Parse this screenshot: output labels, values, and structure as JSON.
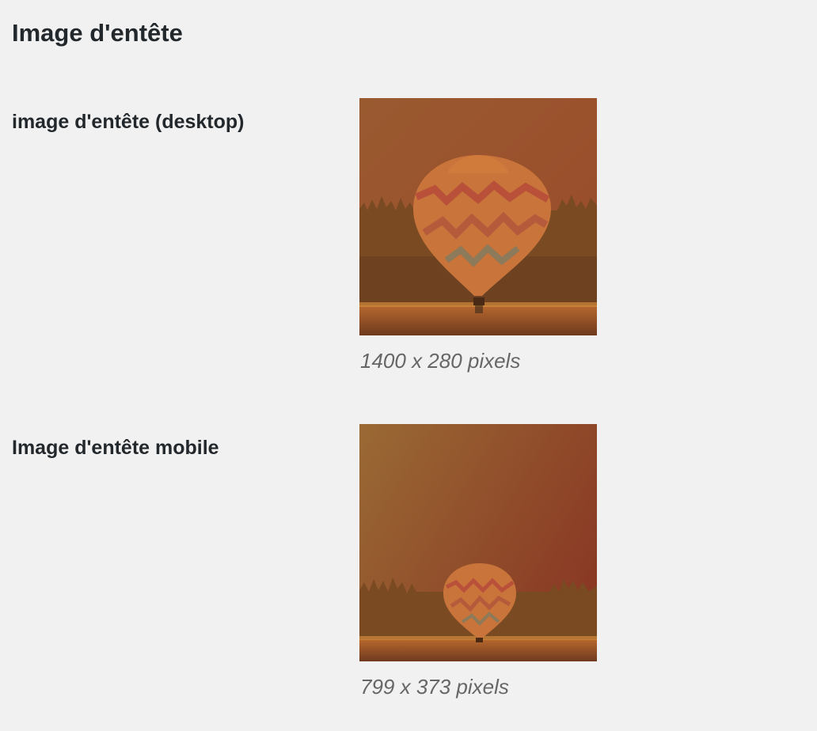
{
  "section": {
    "title": "Image d'entête"
  },
  "fields": [
    {
      "label": "image d'entête (desktop)",
      "dimensions": "1400 x 280 pixels",
      "thumbnail": "hot-air-balloon-orange-tint"
    },
    {
      "label": "Image d'entête mobile",
      "dimensions": "799 x 373 pixels",
      "thumbnail": "hot-air-balloon-orange-tint"
    }
  ],
  "colors": {
    "background": "#f1f1f1",
    "text": "#23282d",
    "caption": "#666666",
    "tint_light": "#a05a2c",
    "tint_dark": "#8a3a22"
  }
}
